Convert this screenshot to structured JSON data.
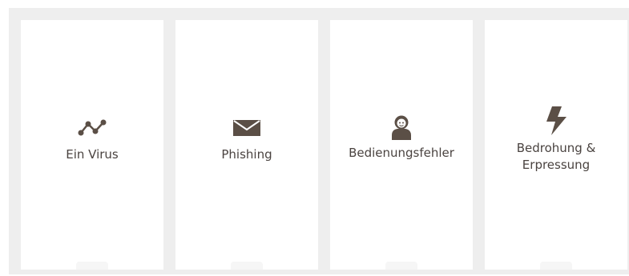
{
  "colors": {
    "panel_background": "#eeeeee",
    "card_background": "#ffffff",
    "icon_color": "#5b4f46",
    "label_color": "#4a4340"
  },
  "cards": [
    {
      "label": "Ein Virus",
      "icon": "line-chart-icon"
    },
    {
      "label": "Phishing",
      "icon": "envelope-icon"
    },
    {
      "label": "Bedienungsfehler",
      "icon": "user-icon"
    },
    {
      "label": "Bedrohung &\nErpressung",
      "icon": "lightning-bolt-icon"
    }
  ]
}
